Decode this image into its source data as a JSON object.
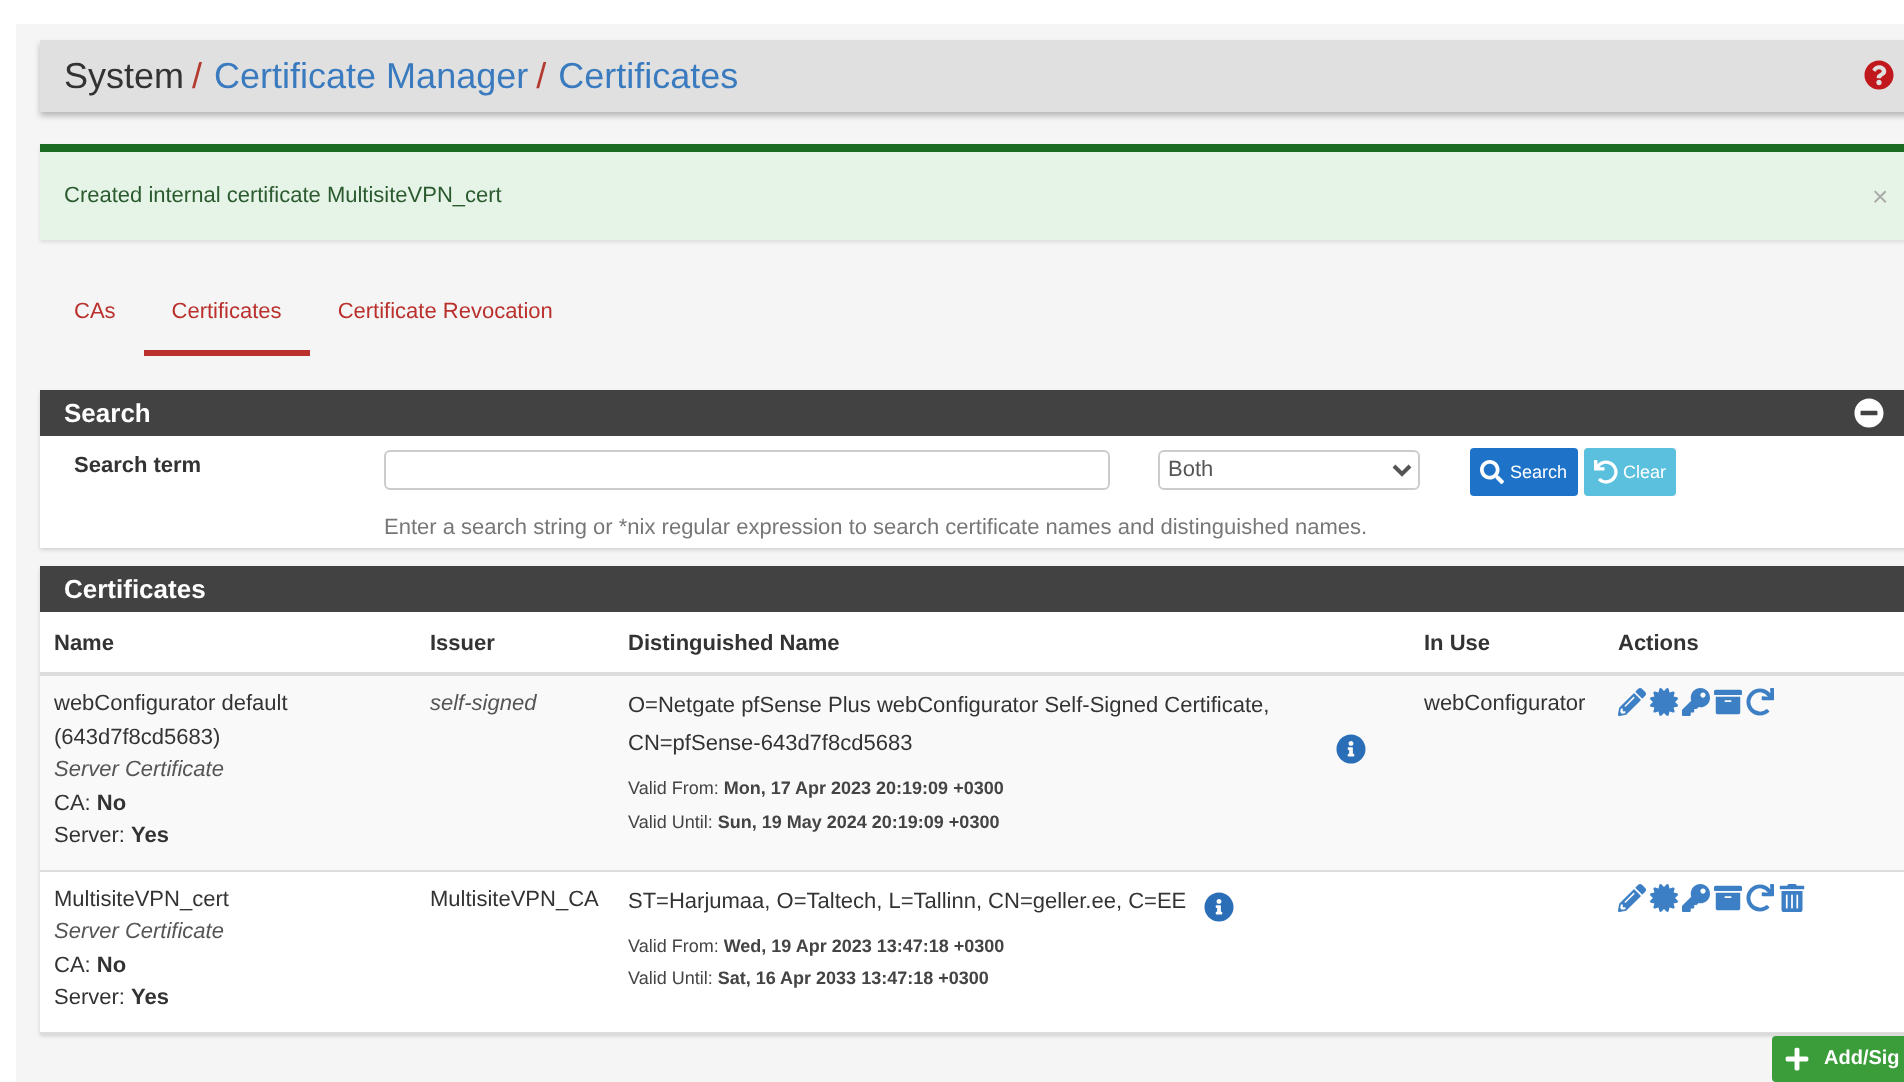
{
  "breadcrumb": {
    "separator": "/",
    "items": [
      {
        "text": "System",
        "link": false
      },
      {
        "text": "Certificate Manager",
        "link": true
      },
      {
        "text": "Certificates",
        "link": true
      }
    ]
  },
  "alert": {
    "message": "Created internal certificate MultisiteVPN_cert",
    "close": "×"
  },
  "tabs": [
    {
      "label": "CAs",
      "selected": false
    },
    {
      "label": "Certificates",
      "selected": true
    },
    {
      "label": "Certificate Revocation",
      "selected": false
    }
  ],
  "search": {
    "title": "Search",
    "label": "Search term",
    "select": "Both",
    "search_button": "Search",
    "clear_button": "Clear",
    "help": "Enter a search string or *nix regular expression to search certificate names and distinguished names."
  },
  "certificates": {
    "title": "Certificates",
    "columns": [
      "Name",
      "Issuer",
      "Distinguished Name",
      "In Use",
      "Actions"
    ],
    "rows": [
      {
        "name": "webConfigurator default (643d7f8cd5683)",
        "type": "Server Certificate",
        "ca": "CA: **No**",
        "server": "Server: **Yes**",
        "issuer": "self-signed",
        "issuer_italic": true,
        "dn": "O=Netgate pfSense Plus webConfigurator Self-Signed Certificate, CN=pfSense-643d7f8cd5683",
        "valid_from": "Valid From: **Mon, 17 Apr 2023 20:19:09 +0300**",
        "valid_until": "Valid Until: **Sun, 19 May 2024 20:19:09 +0300**",
        "in_use": "webConfigurator",
        "deletable": false
      },
      {
        "name": "MultisiteVPN_cert",
        "type": "Server Certificate",
        "ca": "CA: **No**",
        "server": "Server: **Yes**",
        "issuer": "MultisiteVPN_CA",
        "issuer_italic": false,
        "dn": "ST=Harjumaa, O=Taltech, L=Tallinn, CN=geller.ee, C=EE",
        "valid_from": "Valid From: **Wed, 19 Apr 2023 13:47:18 +0300**",
        "valid_until": "Valid Until: **Sat, 16 Apr 2033 13:47:18 +0300**",
        "deletable": true
      }
    ]
  },
  "add_button": "Add/Sig"
}
